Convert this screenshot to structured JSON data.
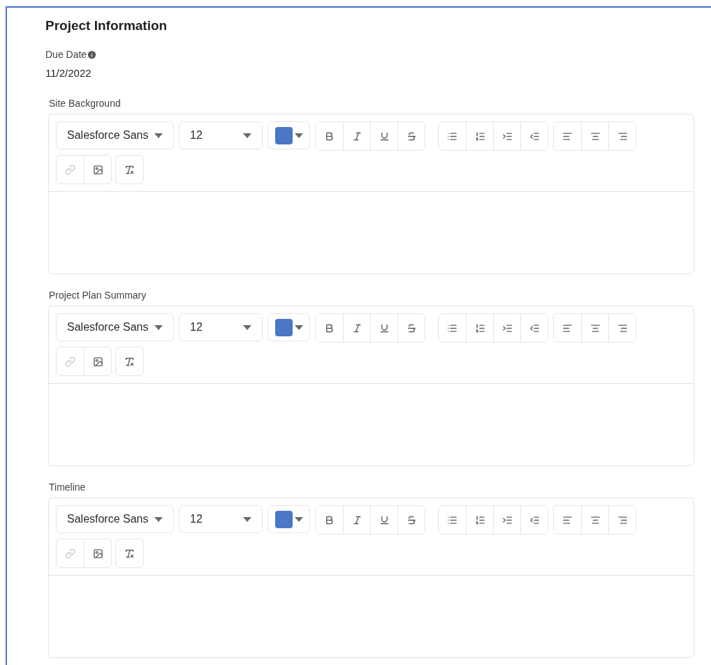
{
  "section": {
    "title": "Project Information"
  },
  "due_date": {
    "label": "Due Date",
    "value": "11/2/2022"
  },
  "editors": [
    {
      "label": "Site Background",
      "font": "Salesforce Sans",
      "size": "12",
      "color": "#4b77c6",
      "link_disabled": true
    },
    {
      "label": "Project Plan Summary",
      "font": "Salesforce Sans",
      "size": "12",
      "color": "#4b77c6",
      "link_disabled": true
    },
    {
      "label": "Timeline",
      "font": "Salesforce Sans",
      "size": "12",
      "color": "#4b77c6",
      "link_disabled": true
    }
  ]
}
